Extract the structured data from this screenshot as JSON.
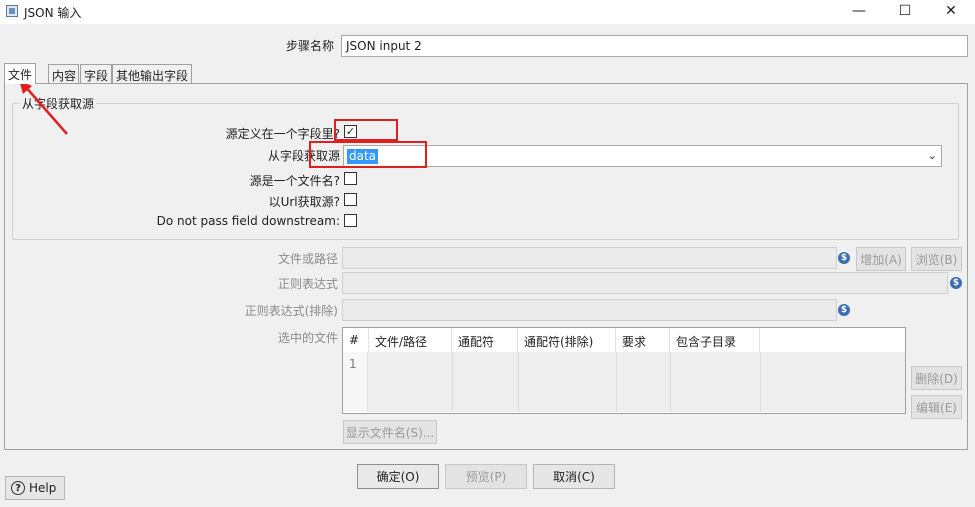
{
  "window": {
    "title": "JSON 输入",
    "minimize_glyph": "—",
    "maximize_glyph": "☐",
    "close_glyph": "✕"
  },
  "step_name": {
    "label": "步骤名称",
    "value": "JSON input 2"
  },
  "tabs": [
    {
      "label": "文件",
      "active": true
    },
    {
      "label": "内容",
      "active": false
    },
    {
      "label": "字段",
      "active": false
    },
    {
      "label": "其他输出字段",
      "active": false
    }
  ],
  "source_group": {
    "title": "从字段获取源",
    "defined_in_field": {
      "label": "源定义在一个字段里?",
      "checked": true,
      "check_glyph": "✓"
    },
    "get_source_from_field": {
      "label": "从字段获取源",
      "value": "data",
      "arrow_glyph": "⌄"
    },
    "source_is_filename": {
      "label": "源是一个文件名?",
      "checked": false
    },
    "read_source_as_url": {
      "label": "以Url获取源?",
      "checked": false
    },
    "do_not_pass_field": {
      "label": "Do not pass field downstream:",
      "checked": false
    }
  },
  "file_section": {
    "file_or_dir_label": "文件或路径",
    "regex_label": "正则表达式",
    "exclude_regex_label": "正则表达式(排除)",
    "selected_files_label": "选中的文件",
    "add_button": "增加(A)",
    "browse_button": "浏览(B)",
    "delete_button": "删除(D)",
    "edit_button": "编辑(E)",
    "show_filenames_button": "显示文件名(S)...",
    "variable_icon_glyph": "$",
    "table": {
      "columns": [
        "#",
        "文件/路径",
        "通配符",
        "通配符(排除)",
        "要求",
        "包含子目录"
      ],
      "rows": [
        [
          "1",
          "",
          "",
          "",
          "",
          ""
        ]
      ]
    }
  },
  "footer": {
    "ok_button": "确定(O)",
    "preview_button": "预览(P)",
    "cancel_button": "取消(C)",
    "help_button": "Help",
    "help_glyph": "?"
  },
  "annotations": {
    "highlight_color": "#e02020"
  }
}
